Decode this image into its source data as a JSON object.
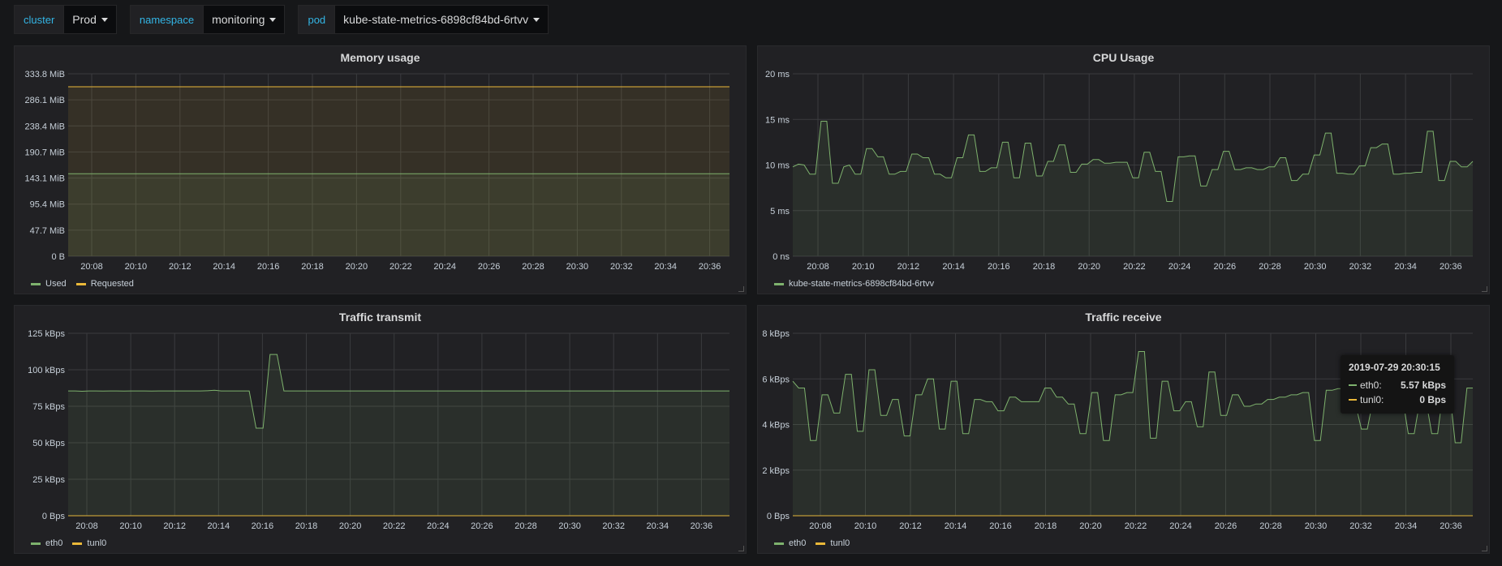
{
  "variables": [
    {
      "label": "cluster",
      "value": "Prod"
    },
    {
      "label": "namespace",
      "value": "monitoring"
    },
    {
      "label": "pod",
      "value": "kube-state-metrics-6898cf84bd-6rtvv"
    }
  ],
  "colors": {
    "green": "#7eb26d",
    "yellow": "#eab839"
  },
  "panels": {
    "memory": {
      "title": "Memory usage",
      "legend": [
        "Used",
        "Requested"
      ]
    },
    "cpu": {
      "title": "CPU Usage",
      "legend": [
        "kube-state-metrics-6898cf84bd-6rtvv"
      ]
    },
    "tx": {
      "title": "Traffic transmit",
      "legend": [
        "eth0",
        "tunl0"
      ]
    },
    "rx": {
      "title": "Traffic receive",
      "legend": [
        "eth0",
        "tunl0"
      ]
    }
  },
  "tooltip": {
    "time": "2019-07-29 20:30:15",
    "rows": [
      {
        "name": "eth0:",
        "value": "5.57 kBps",
        "color": "#7eb26d"
      },
      {
        "name": "tunl0:",
        "value": "0 Bps",
        "color": "#eab839"
      }
    ]
  },
  "chart_data": [
    {
      "type": "area",
      "title": "Memory usage",
      "x_ticks": [
        "20:08",
        "20:10",
        "20:12",
        "20:14",
        "20:16",
        "20:18",
        "20:20",
        "20:22",
        "20:24",
        "20:26",
        "20:28",
        "20:30",
        "20:32",
        "20:34",
        "20:36"
      ],
      "y_ticks": [
        "0 B",
        "47.7 MiB",
        "95.4 MiB",
        "143.1 MiB",
        "190.7 MiB",
        "238.4 MiB",
        "286.1 MiB",
        "333.8 MiB"
      ],
      "ylim": [
        0,
        333.8
      ],
      "series": [
        {
          "name": "Used",
          "color": "#7eb26d",
          "values": [
            151,
            151,
            151,
            151,
            151,
            151,
            151,
            151,
            151,
            151,
            151,
            151,
            151,
            151,
            151
          ]
        },
        {
          "name": "Requested",
          "color": "#eab839",
          "values": [
            310,
            310,
            310,
            310,
            310,
            310,
            310,
            310,
            310,
            310,
            310,
            310,
            310,
            310,
            310
          ]
        }
      ]
    },
    {
      "type": "area",
      "title": "CPU Usage",
      "x_ticks": [
        "20:08",
        "20:10",
        "20:12",
        "20:14",
        "20:16",
        "20:18",
        "20:20",
        "20:22",
        "20:24",
        "20:26",
        "20:28",
        "20:30",
        "20:32",
        "20:34",
        "20:36"
      ],
      "y_ticks": [
        "0 ns",
        "5 ms",
        "10 ms",
        "15 ms",
        "20 ms"
      ],
      "ylim": [
        0,
        20
      ],
      "series": [
        {
          "name": "kube-state-metrics-6898cf84bd-6rtvv",
          "color": "#7eb26d",
          "values": [
            9.8,
            10.1,
            10,
            9,
            9,
            14.8,
            14.8,
            8,
            8,
            9.8,
            10,
            9,
            9,
            11.8,
            11.8,
            10.9,
            10.9,
            9,
            9,
            9.3,
            9.3,
            11.2,
            11.2,
            10.8,
            10.8,
            9,
            9,
            8.6,
            8.6,
            10.8,
            10.8,
            13.3,
            13.3,
            9.3,
            9.3,
            9.7,
            9.7,
            12.5,
            12.5,
            8.6,
            8.6,
            12.4,
            12.4,
            8.8,
            8.8,
            10.4,
            10.4,
            12.2,
            12.2,
            9.2,
            9.2,
            10.1,
            10.1,
            10.6,
            10.6,
            10.2,
            10.2,
            10.3,
            10.3,
            10.3,
            8.6,
            8.6,
            11.4,
            11.4,
            9.3,
            9.3,
            6,
            6,
            10.9,
            10.9,
            11,
            11,
            7.7,
            7.7,
            9.5,
            9.5,
            11.5,
            11.5,
            9.5,
            9.5,
            9.7,
            9.7,
            9.5,
            9.5,
            9.8,
            9.8,
            10.8,
            10.8,
            8.3,
            8.3,
            9,
            9,
            11.1,
            11.1,
            13.5,
            13.5,
            9.1,
            9.1,
            9,
            9,
            9.9,
            9.9,
            11.9,
            11.9,
            12.3,
            12.3,
            9,
            9,
            9.1,
            9.1,
            9.2,
            9.2,
            13.7,
            13.7,
            8.3,
            8.3,
            10.4,
            10.4,
            9.8,
            9.8,
            10.4
          ]
        }
      ]
    },
    {
      "type": "area",
      "title": "Traffic transmit",
      "x_ticks": [
        "20:08",
        "20:10",
        "20:12",
        "20:14",
        "20:16",
        "20:18",
        "20:20",
        "20:22",
        "20:24",
        "20:26",
        "20:28",
        "20:30",
        "20:32",
        "20:34",
        "20:36"
      ],
      "y_ticks": [
        "0 Bps",
        "25 kBps",
        "50 kBps",
        "75 kBps",
        "100 kBps",
        "125 kBps"
      ],
      "ylim": [
        0,
        125
      ],
      "series": [
        {
          "name": "eth0",
          "color": "#7eb26d",
          "values": [
            85.5,
            85.5,
            85.3,
            85.5,
            85.5,
            85.4,
            85.5,
            85.5,
            85.4,
            85.5,
            85.5,
            85.5,
            85.4,
            85.5,
            85.5,
            85.5,
            85.5,
            85.5,
            85.5,
            85.5,
            85.6,
            86,
            85.5,
            85.5,
            85.5,
            85.5,
            85.5,
            60,
            60,
            110.5,
            110.5,
            85.5,
            85.5,
            85.5,
            85.5,
            85.5,
            85.5,
            85.5,
            85.5,
            85.5,
            85.5,
            85.5,
            85.5,
            85.5,
            85.5,
            85.5,
            85.5,
            85.5,
            85.5,
            85.5,
            85.5,
            85.5,
            85.5,
            85.5,
            85.5,
            85.5,
            85.5,
            85.5,
            85.5,
            85.5,
            85.5,
            85.5,
            85.5,
            85.5,
            85.5,
            85.5,
            85.5,
            85.5,
            85.5,
            85.5,
            85.5,
            85.5,
            85.5,
            85.5,
            85.5,
            85.5,
            85.5,
            85.5,
            85.5,
            85.5,
            85.5,
            85.5,
            85.5,
            85.5,
            85.5,
            85.5,
            85.5,
            85.5,
            85.5,
            85.5,
            85.5,
            85.5,
            85.5,
            85.5,
            85.5,
            85.5
          ]
        },
        {
          "name": "tunl0",
          "color": "#eab839",
          "values": [
            0,
            0,
            0,
            0,
            0,
            0,
            0,
            0,
            0,
            0,
            0,
            0,
            0,
            0,
            0
          ]
        }
      ]
    },
    {
      "type": "area",
      "title": "Traffic receive",
      "x_ticks": [
        "20:08",
        "20:10",
        "20:12",
        "20:14",
        "20:16",
        "20:18",
        "20:20",
        "20:22",
        "20:24",
        "20:26",
        "20:28",
        "20:30",
        "20:32",
        "20:34",
        "20:36"
      ],
      "y_ticks": [
        "0 Bps",
        "2 kBps",
        "4 kBps",
        "6 kBps",
        "8 kBps"
      ],
      "ylim": [
        0,
        8
      ],
      "series": [
        {
          "name": "eth0",
          "color": "#7eb26d",
          "values": [
            5.9,
            5.6,
            5.6,
            3.3,
            3.3,
            5.3,
            5.3,
            4.5,
            4.5,
            6.2,
            6.2,
            3.7,
            3.7,
            6.4,
            6.4,
            4.4,
            4.4,
            5.1,
            5.1,
            3.5,
            3.5,
            5.3,
            5.3,
            6,
            6,
            3.8,
            3.8,
            5.9,
            5.9,
            3.6,
            3.6,
            5.1,
            5.1,
            5,
            5,
            4.6,
            4.6,
            5.2,
            5.2,
            5,
            5,
            5,
            5,
            5.6,
            5.6,
            5.2,
            5.2,
            4.9,
            4.9,
            3.6,
            3.6,
            5.4,
            5.4,
            3.3,
            3.3,
            5.3,
            5.3,
            5.4,
            5.4,
            7.2,
            7.2,
            3.4,
            3.4,
            5.9,
            5.9,
            4.6,
            4.6,
            5,
            5,
            3.9,
            3.9,
            6.3,
            6.3,
            4.4,
            4.4,
            5.3,
            5.3,
            4.8,
            4.8,
            4.9,
            4.9,
            5.1,
            5.1,
            5.2,
            5.2,
            5.3,
            5.3,
            5.4,
            5.4,
            3.3,
            3.3,
            5.5,
            5.5,
            5.57,
            5.57,
            4.9,
            4.9,
            3.8,
            3.8,
            5.1,
            5.1,
            4.9,
            4.9,
            5.2,
            5.2,
            3.6,
            3.6,
            5.1,
            5.1,
            3.6,
            3.6,
            5.6,
            5.6,
            3.2,
            3.2,
            5.6,
            5.6
          ]
        },
        {
          "name": "tunl0",
          "color": "#eab839",
          "values": [
            0,
            0,
            0,
            0,
            0,
            0,
            0,
            0,
            0,
            0,
            0,
            0,
            0,
            0,
            0
          ]
        }
      ]
    }
  ]
}
